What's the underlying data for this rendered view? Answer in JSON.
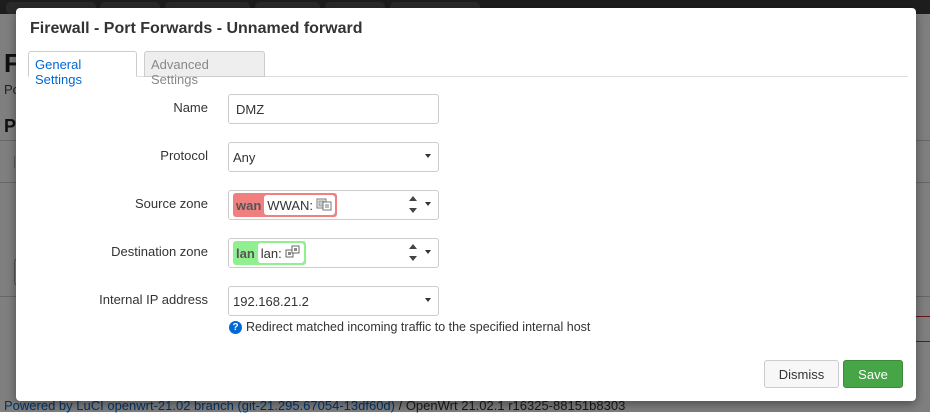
{
  "background": {
    "page_letter": "F",
    "page_sub": "Po",
    "section_letter": "P",
    "footer_link": "Powered by LuCI openwrt-21.02 branch (git-21.295.67054-13df60d)",
    "footer_rest": " / OpenWrt 21.02.1 r16325-88151b8303"
  },
  "modal": {
    "title": "Firewall - Port Forwards - Unnamed forward",
    "tabs": [
      {
        "label": "General Settings",
        "active": true
      },
      {
        "label": "Advanced Settings",
        "active": false
      }
    ],
    "fields": {
      "name": {
        "label": "Name",
        "value": "DMZ"
      },
      "protocol": {
        "label": "Protocol",
        "value": "Any"
      },
      "source_zone": {
        "label": "Source zone",
        "zone": "wan",
        "networks": "WWAN:",
        "color": "#f08080"
      },
      "destination_zone": {
        "label": "Destination zone",
        "zone": "lan",
        "networks": "lan:",
        "color": "#90f090"
      },
      "internal_ip": {
        "label": "Internal IP address",
        "value": "192.168.21.2"
      }
    },
    "hint": "Redirect matched incoming traffic to the specified internal host",
    "buttons": {
      "dismiss": "Dismiss",
      "save": "Save"
    }
  },
  "colors": {
    "accent": "#0069d6",
    "save": "#46a546",
    "wan_zone": "#f08080",
    "lan_zone": "#90f090"
  },
  "icons": {
    "wireless": "wireless-icon",
    "ethernet": "ethernet-icon",
    "help": "help-icon"
  }
}
